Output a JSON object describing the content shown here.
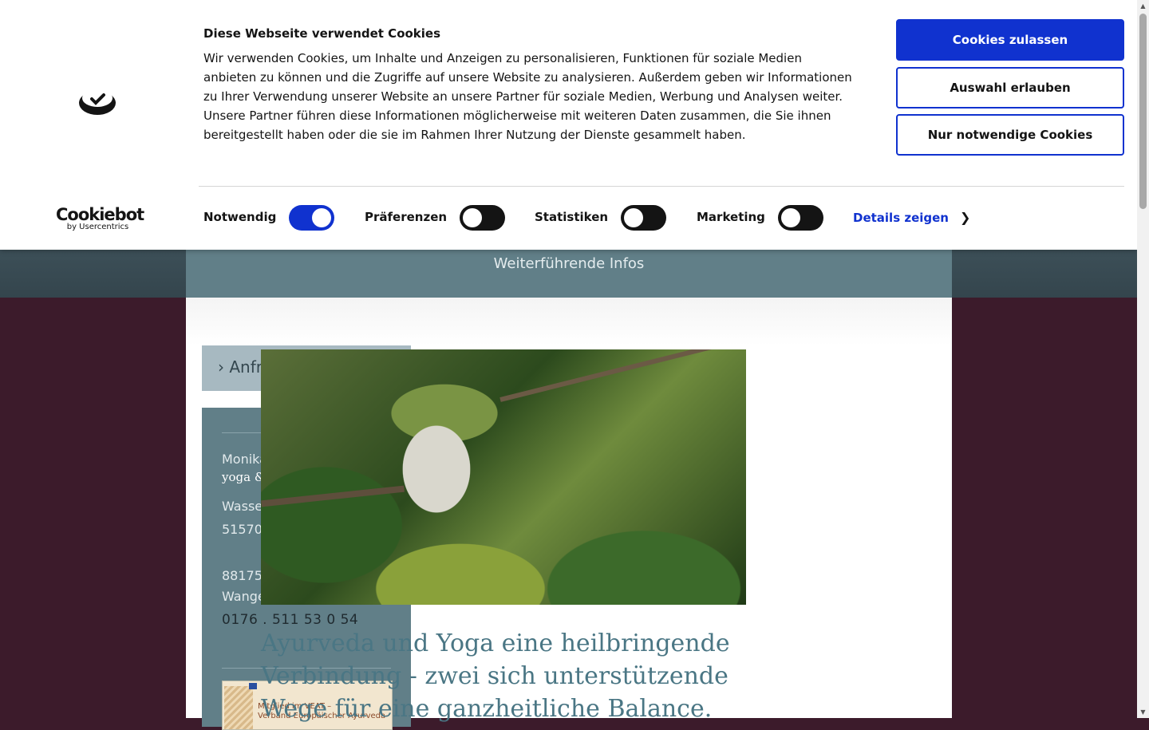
{
  "cookie_banner": {
    "title": "Diese Webseite verwendet Cookies",
    "text": "Wir verwenden Cookies, um Inhalte und Anzeigen zu personalisieren, Funktionen für soziale Medien anbieten zu können und die Zugriffe auf unsere Website zu analysieren. Außerdem geben wir Informationen zu Ihrer Verwendung unserer Website an unsere Partner für soziale Medien, Werbung und Analysen weiter. Unsere Partner führen diese Informationen möglicherweise mit weiteren Daten zusammen, die Sie ihnen bereitgestellt haben oder die sie im Rahmen Ihrer Nutzung der Dienste gesammelt haben.",
    "buttons": {
      "allow_all": "Cookies zulassen",
      "allow_selection": "Auswahl erlauben",
      "necessary_only": "Nur notwendige Cookies"
    },
    "brand": {
      "name": "Cookiebot",
      "sub": "by Usercentrics"
    },
    "toggles": [
      {
        "label": "Notwendig",
        "on": true
      },
      {
        "label": "Präferenzen",
        "on": false
      },
      {
        "label": "Statistiken",
        "on": false
      },
      {
        "label": "Marketing",
        "on": false
      }
    ],
    "details_link": "Details zeigen",
    "accent_color": "#1032cf"
  },
  "nav": {
    "item": "Weiterführende Infos"
  },
  "sidebar": {
    "request_button": "› Anfrage Einzeltermin",
    "contact": {
      "name": "Monika-Natalie Kirsammer",
      "tagline": "yoga & ayurveda & massage",
      "street": "Wasserburg 11",
      "city": "51570 Windeck",
      "city2_line1": "88175 Scheidegg und",
      "city2_line2": "Wangen im Allgäu",
      "phone": "0176 . 511 53 0 54"
    },
    "badge": {
      "line1": "Mitglied im VEAT –",
      "line2": "Verband Europäischer Ayurveda-"
    }
  },
  "main": {
    "headline_line1": "Ayurveda und Yoga eine heilbringende",
    "headline_line2": "Verbindung - zwei sich unterstützende",
    "headline_line3": "Wege für eine ganzheitliche Balance."
  }
}
